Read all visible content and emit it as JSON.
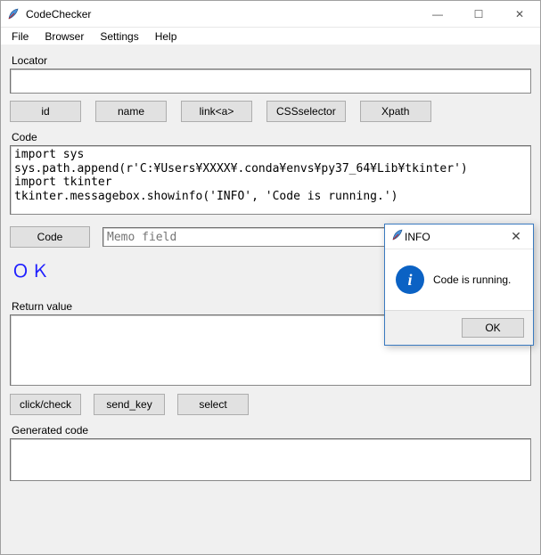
{
  "window": {
    "title": "CodeChecker",
    "controls": {
      "min": "—",
      "max": "☐",
      "close": "✕"
    }
  },
  "menu": {
    "file": "File",
    "browser": "Browser",
    "settings": "Settings",
    "help": "Help"
  },
  "locator": {
    "label": "Locator",
    "value": "",
    "buttons": {
      "id": "id",
      "name": "name",
      "link": "link<a>",
      "css": "CSSselector",
      "xpath": "Xpath"
    }
  },
  "code": {
    "label": "Code",
    "value": "import sys\nsys.path.append(r'C:¥Users¥XXXX¥.conda¥envs¥py37_64¥Lib¥tkinter')\nimport tkinter\ntkinter.messagebox.showinfo('INFO', 'Code is running.')",
    "button": "Code",
    "memo_placeholder": "Memo field"
  },
  "status": "ＯＫ",
  "returnvalue": {
    "label": "Return value",
    "value": "",
    "buttons": {
      "click": "click/check",
      "sendkey": "send_key",
      "select": "select"
    }
  },
  "generated": {
    "label": "Generated code",
    "value": ""
  },
  "dialog": {
    "title": "INFO",
    "message": "Code is running.",
    "ok": "OK",
    "close": "✕"
  }
}
